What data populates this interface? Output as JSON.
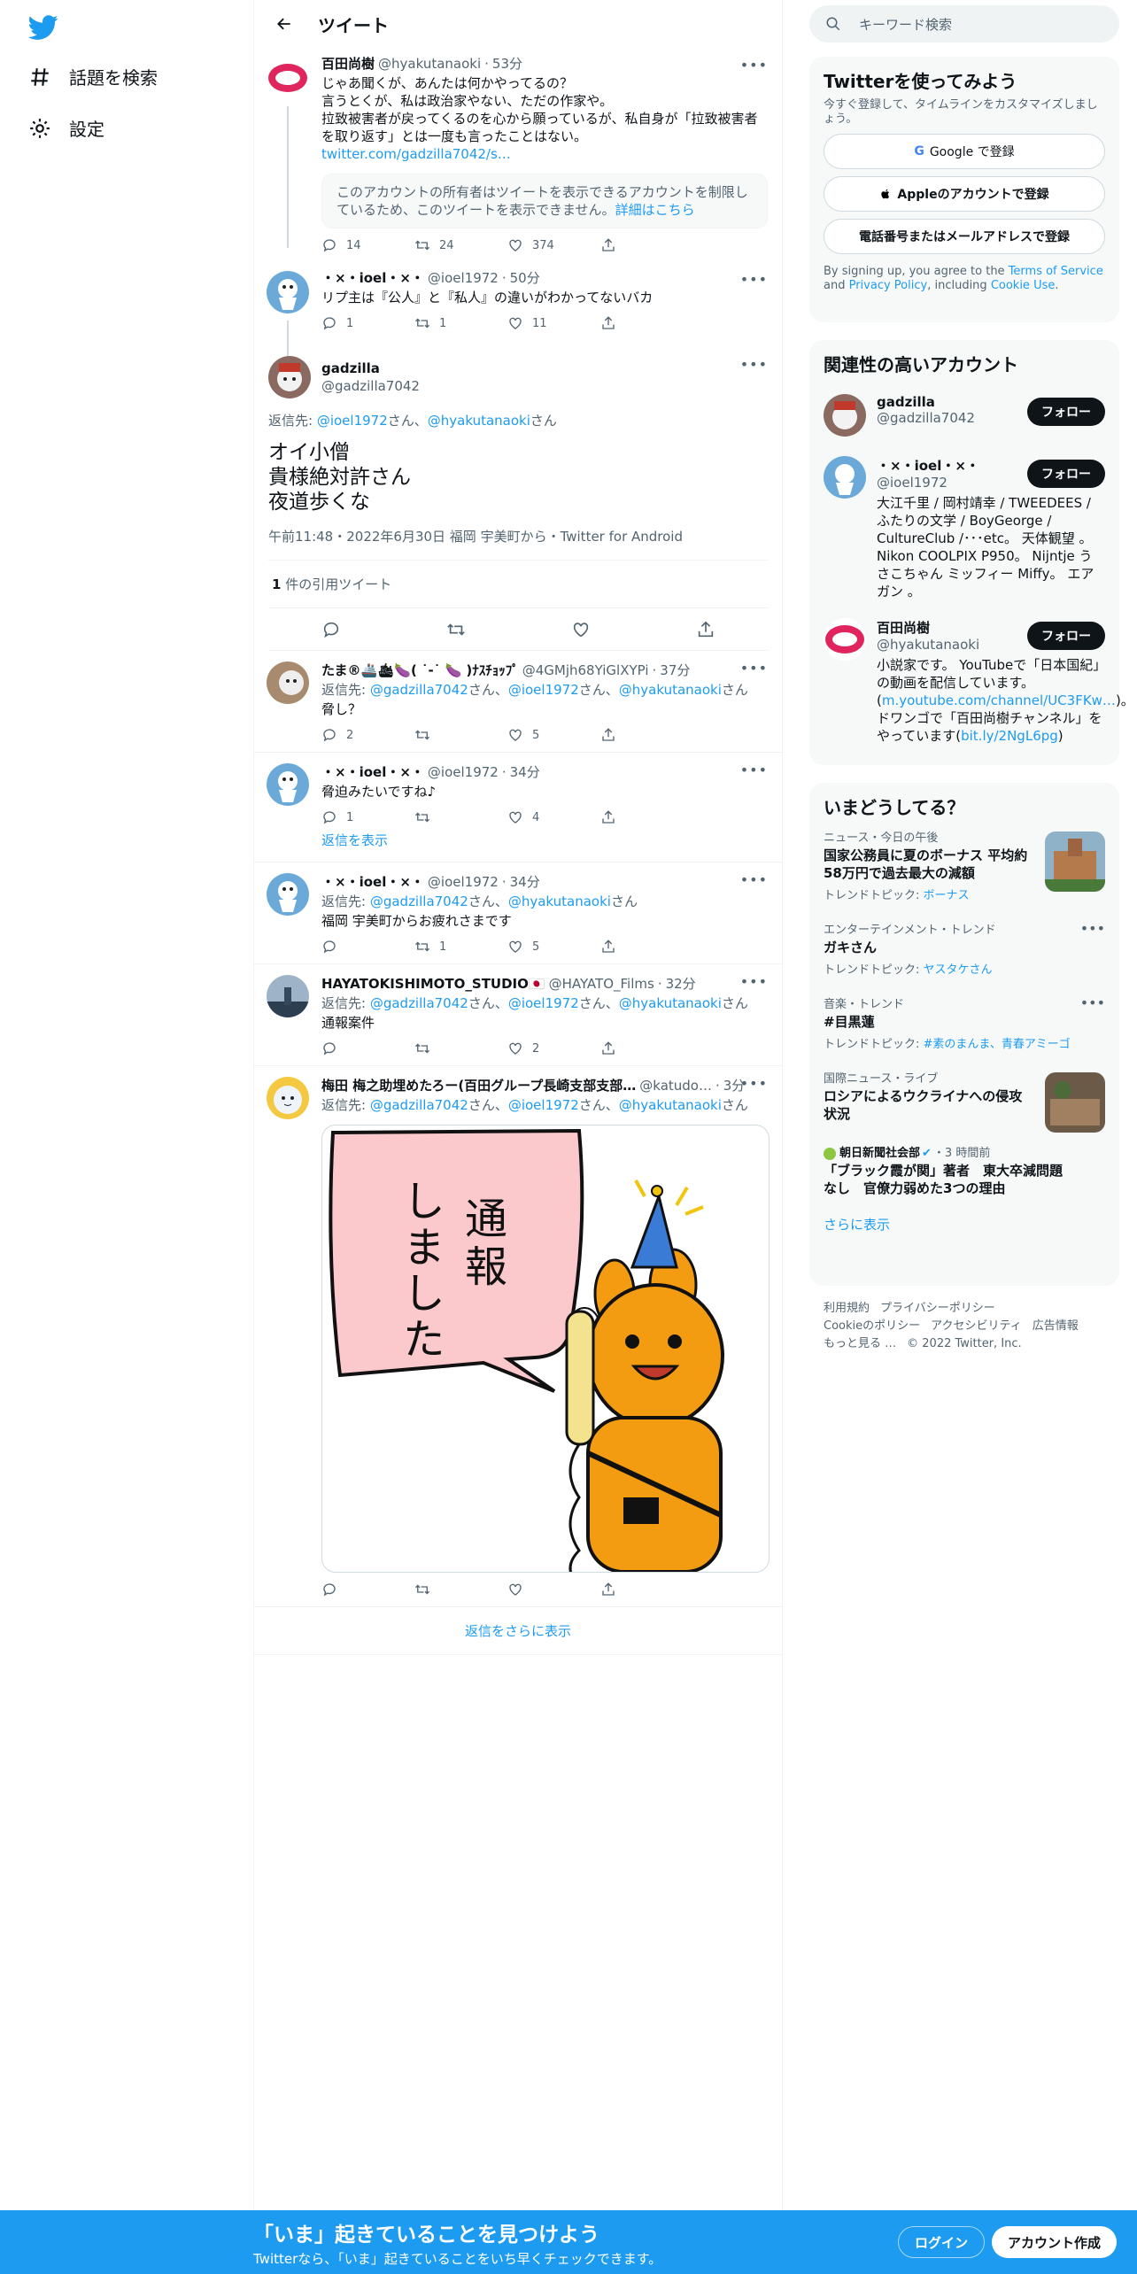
{
  "nav": {
    "explore_label": "話題を検索",
    "settings_label": "設定"
  },
  "header": {
    "title": "ツイート"
  },
  "tweets_above": [
    {
      "name": "百田尚樹",
      "handle": "@hyakutanaoki",
      "time": "53分",
      "text1": "じゃあ聞くが、あんたは何かやってるの？",
      "text2": "言うとくが、私は政治家やない、ただの作家や。",
      "text3": "拉致被害者が戻ってくるのを心から願っているが、私自身が「拉致被害者を取り返す」とは一度も言ったことはない。",
      "link": "twitter.com/gadzilla7042/s…",
      "notice": "このアカウントの所有者はツイートを表示できるアカウントを制限しているため、このツイートを表示できません。",
      "notice_link": "詳細はこちら",
      "replies": "14",
      "retweets": "24",
      "likes": "374"
    },
    {
      "name": "・×・ioel・×・",
      "handle": "@ioel1972",
      "time": "50分",
      "text": "リプ主は『公人』と『私人』の違いがわかってないバカ",
      "replies": "1",
      "retweets": "1",
      "likes": "11"
    }
  ],
  "focused": {
    "name": "gadzilla",
    "handle": "@gadzilla7042",
    "reply_prefix": "返信先: ",
    "reply_to1": "@ioel1972",
    "reply_san1": "さん、",
    "reply_to2": "@hyakutanaoki",
    "reply_san2": "さん",
    "line1": "オイ小僧",
    "line2": "貴様絶対許さん",
    "line3": "夜道歩くな",
    "meta": "午前11:48・2022年6月30日 福岡 宇美町から・Twitter for Android",
    "quote_count": "1",
    "quote_label": " 件の引用ツイート"
  },
  "replies": [
    {
      "name": "たま®🚢🛳🍆( ˙-˙ 🍆 )ﾅｽﾁｮｯﾌﾟ",
      "handle": "@4GMjh68YiGlXYPi",
      "time": "37分",
      "reply_to": [
        "@gadzilla7042",
        "@ioel1972",
        "@hyakutanaoki"
      ],
      "text": "脅し？",
      "replies": "2",
      "retweets": "",
      "likes": "5"
    },
    {
      "name": "・×・ioel・×・",
      "handle": "@ioel1972",
      "time": "34分",
      "text": "脅迫みたいですね♪",
      "replies": "1",
      "retweets": "",
      "likes": "4",
      "show_replies": "返信を表示"
    },
    {
      "name": "・×・ioel・×・",
      "handle": "@ioel1972",
      "time": "34分",
      "reply_to": [
        "@gadzilla7042",
        "@hyakutanaoki"
      ],
      "text": "福岡 宇美町からお疲れさまです",
      "replies": "",
      "retweets": "1",
      "likes": "5"
    },
    {
      "name": "HAYATOKISHIMOTO_STUDIO🇯🇵",
      "handle": "@HAYATO_Films",
      "time": "32分",
      "reply_to": [
        "@gadzilla7042",
        "@ioel1972",
        "@hyakutanaoki"
      ],
      "text": "通報案件",
      "replies": "",
      "retweets": "",
      "likes": "2"
    },
    {
      "name": "梅田 梅之助埋めたろー(百田グループ長崎支部支部…",
      "handle": "@katudo…",
      "time": "3分",
      "reply_to": [
        "@gadzilla7042",
        "@ioel1972",
        "@hyakutanaoki"
      ],
      "image_text": "通報しました"
    }
  ],
  "reply_label": "返信先: ",
  "san": "さん",
  "san_comma": "さん、",
  "more_replies": "返信をさらに表示",
  "search": {
    "placeholder": "キーワード検索"
  },
  "signup_panel": {
    "title": "Twitterを使ってみよう",
    "subtitle": "今すぐ登録して、タイムラインをカスタマイズしましょう。",
    "google": "Google で登録",
    "apple": "Appleのアカウントで登録",
    "phone": "電話番号またはメールアドレスで登録",
    "terms_prefix": "By signing up, you agree to the ",
    "tos": "Terms of Service",
    "and": " and ",
    "privacy": "Privacy Policy",
    "including": ", including ",
    "cookie": "Cookie Use",
    "period": "."
  },
  "relevant": {
    "title": "関連性の高いアカウント",
    "follow": "フォロー",
    "accounts": [
      {
        "name": "gadzilla",
        "handle": "@gadzilla7042",
        "bio": ""
      },
      {
        "name": "・×・ioel・×・",
        "handle": "@ioel1972",
        "bio": "大江千里 / 岡村靖幸 / TWEEDEES / ふたりの文学 / BoyGeorge / CultureClub /･･･etc。 天体観望 。 Nikon COOLPIX P950。 Nijntje うさこちゃん ミッフィー Miffy。 エアガン 。"
      },
      {
        "name": "百田尚樹",
        "handle": "@hyakutanaoki",
        "bio": "小説家です。 YouTubeで「日本国紀」の動画を配信しています。(",
        "bio_link": "m.youtube.com/channel/UC3FKw…",
        "bio2": ")。ドワンゴで「百田尚樹チャンネル」をやっています(",
        "bio_link2": "bit.ly/2NgL6pg",
        "bio3": ")"
      }
    ]
  },
  "trends": {
    "title": "いまどうしてる？",
    "items": [
      {
        "meta": "ニュース・今日の午後",
        "title": "国家公務員に夏のボーナス 平均約58万円で過去最大の減額",
        "topic_label": "トレンドトピック: ",
        "topic": "ボーナス"
      },
      {
        "meta": "エンターテインメント・トレンド",
        "title": "ガキさん",
        "topic_label": "トレンドトピック: ",
        "topic": "ヤスタケさん"
      },
      {
        "meta": "音楽・トレンド",
        "title": "#目黒蓮",
        "topic_label": "トレンドトピック: ",
        "topic": "#素のまんま、青春アミーゴ"
      },
      {
        "meta": "国際ニュース・ライブ",
        "title": "ロシアによるウクライナへの侵攻状況"
      },
      {
        "source": "朝日新聞社会部",
        "time": "・3 時間前",
        "title": "「ブラック霞が関」著者　東大卒減問題なし　官僚力弱めた3つの理由"
      }
    ],
    "show_more": "さらに表示"
  },
  "footer": {
    "tos": "利用規約",
    "privacy": "プライバシーポリシー",
    "cookie": "Cookieのポリシー",
    "access": "アクセシビリティ",
    "ads": "広告情報",
    "more": "もっと見る …",
    "copyright": "© 2022 Twitter, Inc."
  },
  "bottom": {
    "title": "「いま」起きていることを見つけよう",
    "subtitle": "Twitterなら、「いま」起きていることをいち早くチェックできます。",
    "login": "ログイン",
    "signup": "アカウント作成"
  },
  "colors": {
    "accent": "#1d9bf0",
    "text": "#0f1419",
    "muted": "#536471"
  }
}
